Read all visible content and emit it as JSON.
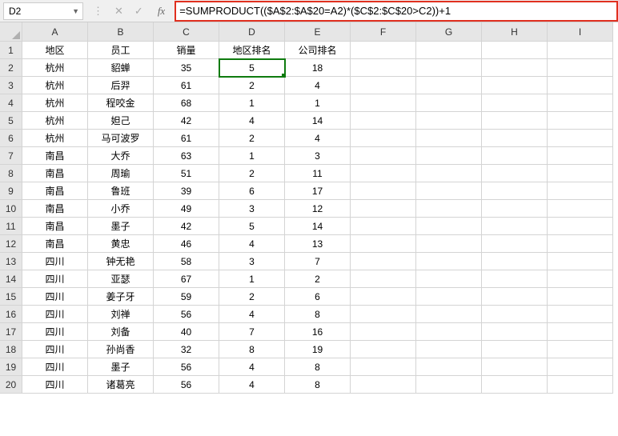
{
  "nameBox": {
    "value": "D2"
  },
  "formulaBar": {
    "value": "=SUMPRODUCT(($A$2:$A$20=A2)*($C$2:$C$20>C2))+1"
  },
  "columns": [
    "A",
    "B",
    "C",
    "D",
    "E",
    "F",
    "G",
    "H",
    "I"
  ],
  "headers": {
    "A": "地区",
    "B": "员工",
    "C": "销量",
    "D": "地区排名",
    "E": "公司排名"
  },
  "rows": [
    {
      "n": 1,
      "A": "地区",
      "B": "员工",
      "C": "销量",
      "D": "地区排名",
      "E": "公司排名"
    },
    {
      "n": 2,
      "A": "杭州",
      "B": "貂蝉",
      "C": 35,
      "D": 5,
      "E": 18
    },
    {
      "n": 3,
      "A": "杭州",
      "B": "后羿",
      "C": 61,
      "D": 2,
      "E": 4
    },
    {
      "n": 4,
      "A": "杭州",
      "B": "程咬金",
      "C": 68,
      "D": 1,
      "E": 1
    },
    {
      "n": 5,
      "A": "杭州",
      "B": "妲己",
      "C": 42,
      "D": 4,
      "E": 14
    },
    {
      "n": 6,
      "A": "杭州",
      "B": "马可波罗",
      "C": 61,
      "D": 2,
      "E": 4
    },
    {
      "n": 7,
      "A": "南昌",
      "B": "大乔",
      "C": 63,
      "D": 1,
      "E": 3
    },
    {
      "n": 8,
      "A": "南昌",
      "B": "周瑜",
      "C": 51,
      "D": 2,
      "E": 11
    },
    {
      "n": 9,
      "A": "南昌",
      "B": "鲁班",
      "C": 39,
      "D": 6,
      "E": 17
    },
    {
      "n": 10,
      "A": "南昌",
      "B": "小乔",
      "C": 49,
      "D": 3,
      "E": 12
    },
    {
      "n": 11,
      "A": "南昌",
      "B": "墨子",
      "C": 42,
      "D": 5,
      "E": 14
    },
    {
      "n": 12,
      "A": "南昌",
      "B": "黄忠",
      "C": 46,
      "D": 4,
      "E": 13
    },
    {
      "n": 13,
      "A": "四川",
      "B": "钟无艳",
      "C": 58,
      "D": 3,
      "E": 7
    },
    {
      "n": 14,
      "A": "四川",
      "B": "亚瑟",
      "C": 67,
      "D": 1,
      "E": 2
    },
    {
      "n": 15,
      "A": "四川",
      "B": "姜子牙",
      "C": 59,
      "D": 2,
      "E": 6
    },
    {
      "n": 16,
      "A": "四川",
      "B": "刘禅",
      "C": 56,
      "D": 4,
      "E": 8
    },
    {
      "n": 17,
      "A": "四川",
      "B": "刘备",
      "C": 40,
      "D": 7,
      "E": 16
    },
    {
      "n": 18,
      "A": "四川",
      "B": "孙尚香",
      "C": 32,
      "D": 8,
      "E": 19
    },
    {
      "n": 19,
      "A": "四川",
      "B": "墨子",
      "C": 56,
      "D": 4,
      "E": 8
    },
    {
      "n": 20,
      "A": "四川",
      "B": "诸葛亮",
      "C": 56,
      "D": 4,
      "E": 8
    }
  ],
  "selection": {
    "cell": "D2"
  }
}
